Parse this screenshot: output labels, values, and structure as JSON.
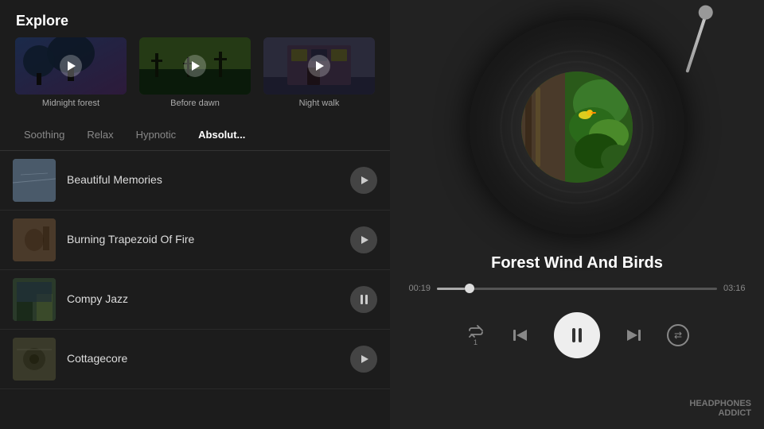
{
  "left": {
    "title": "Explore",
    "featured": [
      {
        "label": "Midnight forest"
      },
      {
        "label": "Before dawn"
      },
      {
        "label": "Night walk"
      }
    ],
    "tabs": [
      {
        "label": "Soothing",
        "active": false
      },
      {
        "label": "Relax",
        "active": false
      },
      {
        "label": "Hypnotic",
        "active": false
      },
      {
        "label": "Absolut...",
        "active": true
      }
    ],
    "tracks": [
      {
        "name": "Beautiful Memories",
        "btn": "play"
      },
      {
        "name": "Burning Trapezoid Of Fire",
        "btn": "play"
      },
      {
        "name": "Compy Jazz",
        "btn": "pause"
      },
      {
        "name": "Cottagecore",
        "btn": "play"
      }
    ]
  },
  "right": {
    "song_title": "Forest Wind And Birds",
    "time_current": "00:19",
    "time_total": "03:16",
    "progress_pct": 10,
    "controls": {
      "repeat": "↺",
      "skip_back": "⏮",
      "play_pause": "pause",
      "skip_fwd": "⏭",
      "shuffle": "⇄"
    }
  },
  "watermark": {
    "line1": "HEADPHONES",
    "line2": "ADDICT"
  }
}
